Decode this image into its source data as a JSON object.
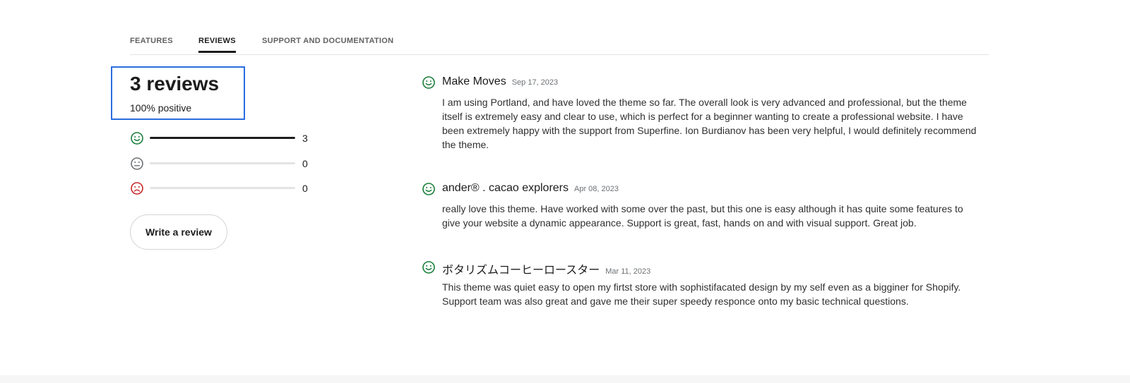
{
  "tabs": [
    {
      "label": "FEATURES",
      "active": false
    },
    {
      "label": "REVIEWS",
      "active": true
    },
    {
      "label": "SUPPORT AND DOCUMENTATION",
      "active": false
    }
  ],
  "summary": {
    "title": "3 reviews",
    "subtitle": "100% positive"
  },
  "distribution": [
    {
      "sentiment": "positive",
      "icon": "smiley-face-icon",
      "count": "3",
      "fraction": 1.0,
      "color": "#1a7d3a"
    },
    {
      "sentiment": "neutral",
      "icon": "neutral-face-icon",
      "count": "0",
      "fraction": 0.0,
      "color": "#6d7175"
    },
    {
      "sentiment": "negative",
      "icon": "sad-face-icon",
      "count": "0",
      "fraction": 0.0,
      "color": "#c62828"
    }
  ],
  "write_review_label": "Write a review",
  "reviews": [
    {
      "author": "Make Moves",
      "date": "Sep 17, 2023",
      "sentiment": "positive",
      "icon": "smiley-face-icon",
      "text": "I am using Portland, and have loved the theme so far. The overall look is very advanced and professional, but the theme itself is extremely easy and clear to use, which is perfect for a beginner wanting to create a professional website. I have been extremely happy with the support from Superfine. Ion Burdianov has been very helpful, I would definitely recommend the theme."
    },
    {
      "author": "ander® . cacao explorers",
      "date": "Apr 08, 2023",
      "sentiment": "positive",
      "icon": "smiley-face-icon",
      "text": "really love this theme. Have worked with some over the past, but this one is easy although it has quite some features to give your website a dynamic appearance. Support is great, fast, hands on and with visual support. Great job."
    },
    {
      "author": "ボタリズムコーヒーロースター",
      "date": "Mar 11, 2023",
      "sentiment": "positive",
      "icon": "smiley-face-icon",
      "text": "This theme was quiet easy to open my firtst store with sophistifacated design by my self even as a bigginer for Shopify. Support team was also great and gave me their super speedy responce onto my basic technical questions."
    }
  ],
  "colors": {
    "accent_focus": "#2a6de0",
    "positive": "#1a7d3a",
    "neutral": "#6d7175",
    "negative": "#c62828",
    "text": "#1c1c1c"
  }
}
